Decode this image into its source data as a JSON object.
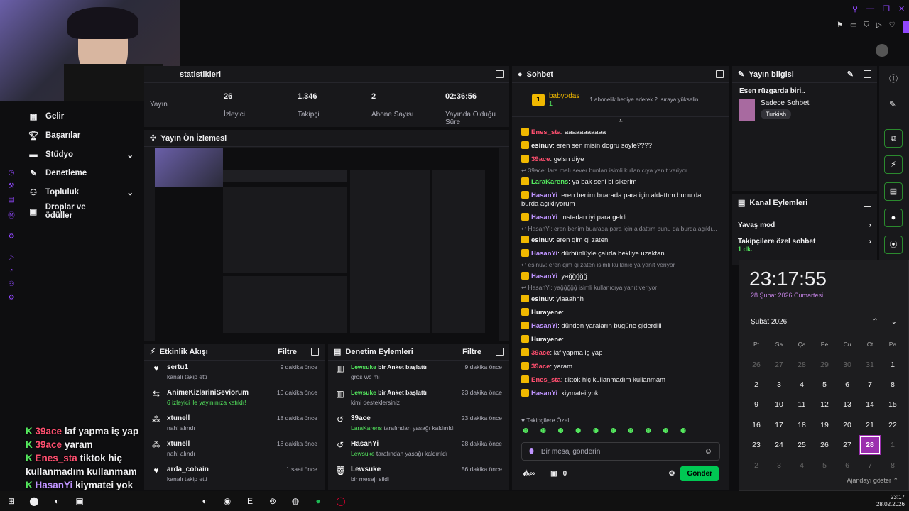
{
  "stats": {
    "title": "statistikleri",
    "items": [
      {
        "value": "",
        "label": "Yayın"
      },
      {
        "value": "26",
        "label": "İzleyici"
      },
      {
        "value": "1.346",
        "label": "Takipçi"
      },
      {
        "value": "2",
        "label": "Abone Sayısı"
      },
      {
        "value": "02:36:56",
        "label": "Yayında Olduğu Süre"
      }
    ]
  },
  "preview": {
    "title": "Yayın Ön İzlemesi"
  },
  "sidebar": {
    "items": [
      {
        "label": "Gelir",
        "icon": "dollar-icon"
      },
      {
        "label": "Başarılar",
        "icon": "trophy-icon"
      },
      {
        "label": "Stüdyo",
        "icon": "studio-icon",
        "chev": true
      },
      {
        "label": "Denetleme",
        "icon": "wrench-icon"
      },
      {
        "label": "Topluluk",
        "icon": "people-icon",
        "chev": true
      },
      {
        "label": "Droplar ve ödüller",
        "icon": "gift-icon"
      }
    ]
  },
  "activity": {
    "title": "Etkinlik Akışı",
    "filter": "Filtre",
    "items": [
      {
        "name": "sertu1",
        "sub": "kanalı takip etti",
        "time": "9 dakika önce"
      },
      {
        "name": "AnimeKizlariniSeviorum",
        "sub": "6 izleyici ile yayınınıza katıldı!",
        "time": "10 dakika önce"
      },
      {
        "name": "xtunell",
        "sub": "nah! alındı",
        "time": "18 dakika önce"
      },
      {
        "name": "xtunell",
        "sub": "nah! alındı",
        "time": "18 dakika önce"
      },
      {
        "name": "arda_cobain",
        "sub": "kanalı takip etti",
        "time": "1 saat önce"
      }
    ]
  },
  "mod": {
    "title": "Denetim Eylemleri",
    "filter": "Filtre",
    "items": [
      {
        "name": "Lewsuke",
        "action": " bir Anket başlattı",
        "sub": "gros wc mi",
        "time": "9 dakika önce"
      },
      {
        "name": "Lewsuke",
        "action": " bir Anket başlattı",
        "sub": "kimi desteklersiniz",
        "time": "23 dakika önce"
      },
      {
        "name": "39ace",
        "action": "",
        "sub1": "LaraKarens",
        "sub": " tarafından yasağı kaldırıldı",
        "time": "23 dakika önce"
      },
      {
        "name": "HasanYi",
        "action": "",
        "sub1": "Lewsuke",
        "sub": " tarafından yasağı kaldırıldı",
        "time": "28 dakika önce"
      },
      {
        "name": "Lewsuke",
        "action": "",
        "sub": "bir mesajı sildi",
        "time": "56 dakika önce"
      }
    ]
  },
  "chat": {
    "title": "Sohbet",
    "pinned_user": "babyodas",
    "pinned_count": "1",
    "pinned_msg": "1 abonelik hediye ederek 2. sıraya yükselin",
    "lines": [
      {
        "user": "Enes_sta",
        "color": "#ff4f6f",
        "msg": "aaaaaaaaaaa"
      },
      {
        "user": "esinuv",
        "color": "#efeff1",
        "msg": "eren sen misin dogru soyle????"
      },
      {
        "user": "39ace",
        "color": "#ff4f6f",
        "msg": "gelsn diye"
      },
      {
        "reply": "39ace: lara malı sever bunları isimli kullanıcıya yanıt veriyor"
      },
      {
        "user": "LaraKarens",
        "color": "#54e85e",
        "msg": "ya bak seni bi sikerim"
      },
      {
        "user": "HasanYi",
        "color": "#bf94ff",
        "msg": "eren benim buarada para için aldattım bunu da burda açıklıyorum"
      },
      {
        "user": "HasanYi",
        "color": "#bf94ff",
        "msg": "instadan iyi para geldi"
      },
      {
        "reply": "HasanYi: eren benim buarada para için aldattım bunu da burda açıklı..."
      },
      {
        "user": "esinuv",
        "color": "#efeff1",
        "msg": "eren qim qi zaten"
      },
      {
        "user": "HasanYi",
        "color": "#bf94ff",
        "msg": "dürbünlüyle çalıda bekliye uzaktan"
      },
      {
        "reply": "esinuv: eren qim qi zaten isimli kullanıcıya yanıt veriyor"
      },
      {
        "user": "HasanYi",
        "color": "#bf94ff",
        "msg": "yağğğğğ"
      },
      {
        "reply": "HasanYi: yağğğğğ isimli kullanıcıya yanıt veriyor"
      },
      {
        "user": "esinuv",
        "color": "#efeff1",
        "msg": "yiaaahhh"
      },
      {
        "user": "Hurayene",
        "color": "#efeff1",
        "msg": ""
      },
      {
        "user": "HasanYi",
        "color": "#bf94ff",
        "msg": "dünden yaraların bugüne giderdiii"
      },
      {
        "user": "Hurayene",
        "color": "#efeff1",
        "msg": ""
      },
      {
        "user": "39ace",
        "color": "#ff4f6f",
        "msg": "laf yapma iş yap"
      },
      {
        "user": "39ace",
        "color": "#ff4f6f",
        "msg": "yaram"
      },
      {
        "user": "Enes_sta",
        "color": "#ff4f6f",
        "msg": "tiktok hiç kullanmadım kullanmam"
      },
      {
        "user": "HasanYi",
        "color": "#bf94ff",
        "msg": "kiymatei yok"
      }
    ],
    "followers_only": "Takipçilere Özel",
    "placeholder": "Bir mesaj gönderin",
    "points": "0",
    "send": "Gönder"
  },
  "info": {
    "title": "Yayın bilgisi",
    "stream_title": "Esen rüzgarda biri..",
    "category": "Sadece Sohbet",
    "language": "Turkish"
  },
  "channel": {
    "title": "Kanal Eylemleri",
    "items": [
      {
        "label": "Yavaş mod"
      },
      {
        "label": "Takipçilere özel sohbet",
        "sub": "1 dk."
      }
    ]
  },
  "clock": {
    "time": "23:17:55",
    "date": "28 Şubat 2026 Cumartesi",
    "month": "Şubat 2026",
    "days": [
      "Pt",
      "Sa",
      "Ça",
      "Pe",
      "Cu",
      "Ct",
      "Pa"
    ],
    "weeks": [
      [
        "26",
        "27",
        "28",
        "29",
        "30",
        "31",
        "1"
      ],
      [
        "2",
        "3",
        "4",
        "5",
        "6",
        "7",
        "8"
      ],
      [
        "9",
        "10",
        "11",
        "12",
        "13",
        "14",
        "15"
      ],
      [
        "16",
        "17",
        "18",
        "19",
        "20",
        "21",
        "22"
      ],
      [
        "23",
        "24",
        "25",
        "26",
        "27",
        "28",
        "1"
      ],
      [
        "2",
        "3",
        "4",
        "5",
        "6",
        "7",
        "8"
      ]
    ],
    "agenda": "Ajandayı göster"
  },
  "overlay": [
    {
      "user": "39ace",
      "color": "#ff4f6f",
      "msg": "laf yapma iş yap"
    },
    {
      "user": "39ace",
      "color": "#ff4f6f",
      "msg": "yaram"
    },
    {
      "user": "Enes_sta",
      "color": "#ff4f6f",
      "msg": "tiktok hiç kullanmadım kullanmam"
    },
    {
      "user": "HasanYi",
      "color": "#bf94ff",
      "msg": "kiymatei yok"
    }
  ],
  "taskbar": {
    "time": "23:17",
    "date": "28.02.2026"
  }
}
